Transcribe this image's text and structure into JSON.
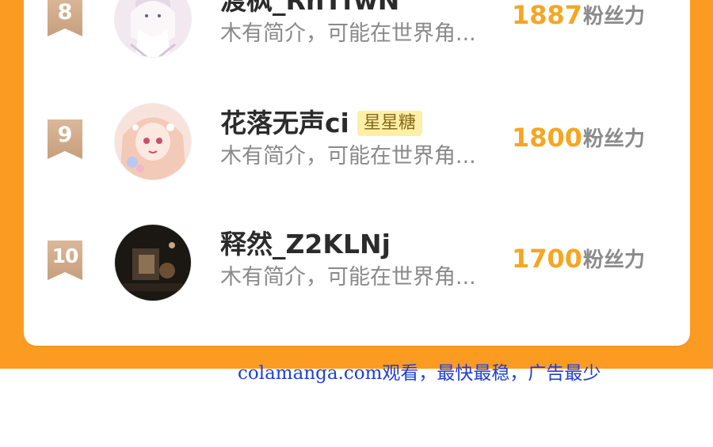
{
  "leaderboard": {
    "rows": [
      {
        "rank": "8",
        "name": "渡枫_RhTfwN",
        "tag": "",
        "desc": "木有简介，可能在世界角...",
        "score": "1887",
        "unit": "粉丝力",
        "avatar_icon": "anime-portrait-pale"
      },
      {
        "rank": "9",
        "name": "花落无声ci",
        "tag": "星星糖",
        "desc": "木有简介，可能在世界角...",
        "score": "1800",
        "unit": "粉丝力",
        "avatar_icon": "anime-portrait-pink"
      },
      {
        "rank": "10",
        "name": "释然_Z2KLNj",
        "tag": "",
        "desc": "木有简介，可能在世界角...",
        "score": "1700",
        "unit": "粉丝力",
        "avatar_icon": "dark-photo"
      }
    ]
  },
  "watermark": "colamanga.com观看，最快最稳，广告最少",
  "colors": {
    "accent_orange": "#fb9b22",
    "score_gold": "#f6a623",
    "tag_bg": "#fdf0a6"
  }
}
